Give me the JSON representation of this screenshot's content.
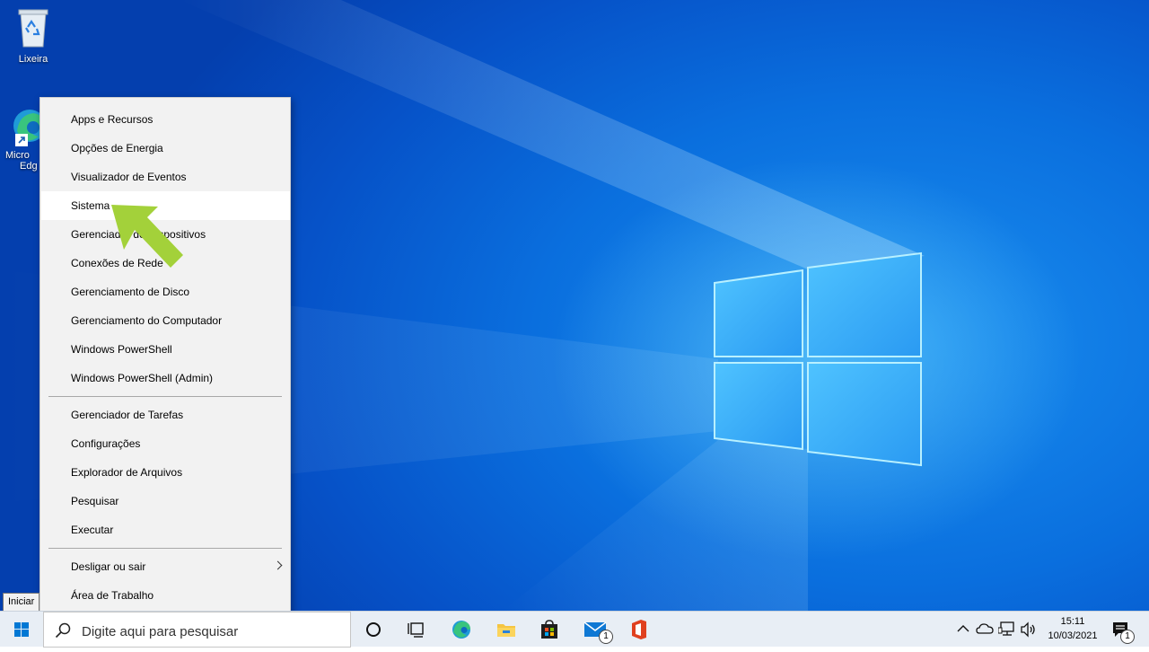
{
  "desktop": {
    "icons": [
      {
        "label": "Lixeira"
      },
      {
        "label_line1": "Micro",
        "label_line2": "Edg"
      }
    ]
  },
  "context_menu": {
    "group1": [
      {
        "label": "Apps e Recursos"
      },
      {
        "label": "Opções de Energia"
      },
      {
        "label": "Visualizador de Eventos"
      },
      {
        "label": "Sistema",
        "highlighted": true
      },
      {
        "label": "Gerenciador de Dispositivos"
      },
      {
        "label": "Conexões de Rede"
      },
      {
        "label": "Gerenciamento de Disco"
      },
      {
        "label": "Gerenciamento do Computador"
      },
      {
        "label": "Windows PowerShell"
      },
      {
        "label": "Windows PowerShell (Admin)"
      }
    ],
    "group2": [
      {
        "label": "Gerenciador de Tarefas"
      },
      {
        "label": "Configurações"
      },
      {
        "label": "Explorador de Arquivos"
      },
      {
        "label": "Pesquisar"
      },
      {
        "label": "Executar"
      }
    ],
    "group3": [
      {
        "label": "Desligar ou sair",
        "has_submenu": true
      },
      {
        "label": "Área de Trabalho"
      }
    ]
  },
  "tooltip": {
    "text": "Iniciar"
  },
  "taskbar": {
    "search_placeholder": "Digite aqui para pesquisar",
    "mail_badge": "1",
    "notification_badge": "1",
    "clock_time": "15:11",
    "clock_date": "10/03/2021"
  },
  "colors": {
    "arrow": "#a3d13a",
    "desktop_blue": "#0a6fde",
    "menu_bg": "#f2f2f2",
    "taskbar_bg": "#e8eef5"
  }
}
